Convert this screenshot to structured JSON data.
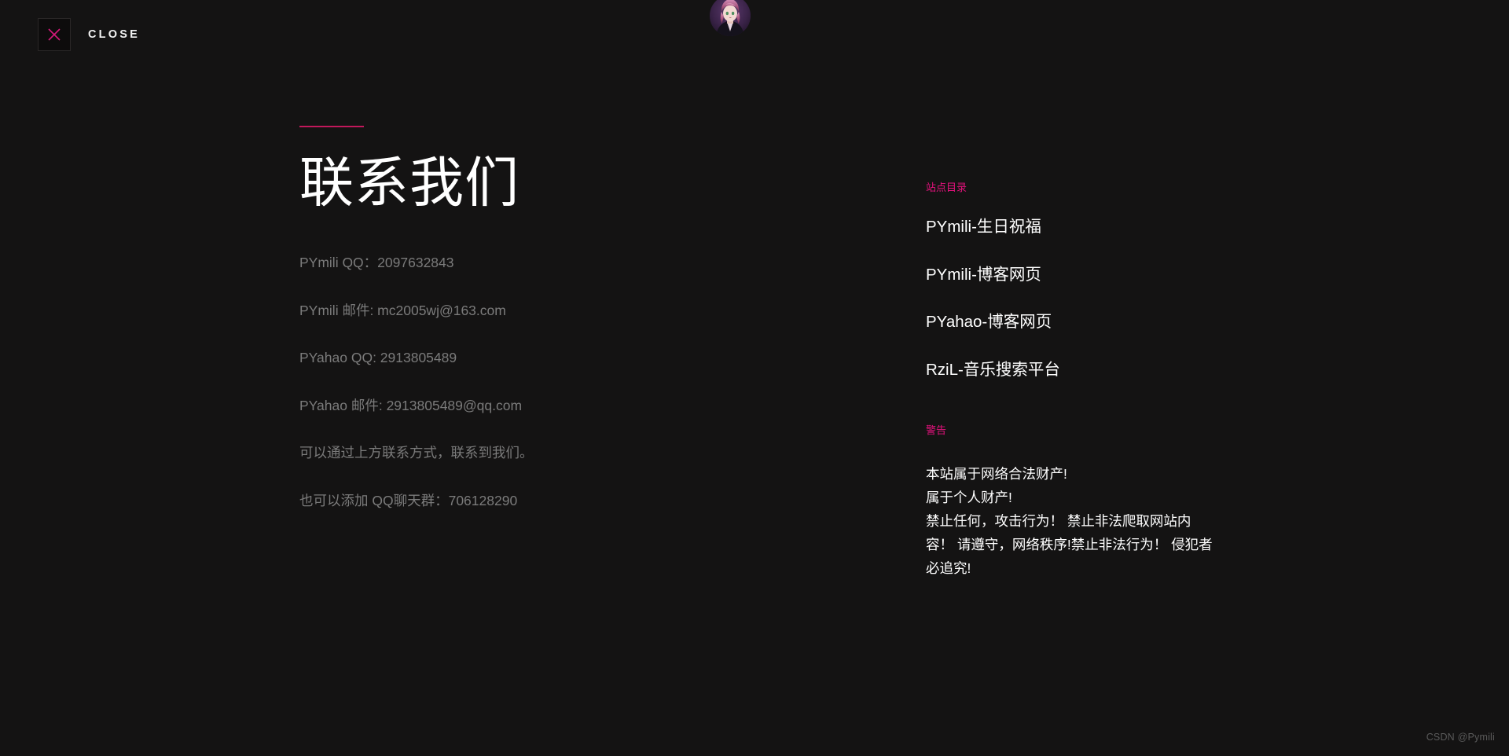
{
  "theme": {
    "background": "#141313",
    "accent_pink": "#e5127d",
    "accent_rule": "#c2185b",
    "muted_text": "#7b7b7b",
    "body_text": "#ffffff",
    "watermark_text_color": "#5a5a5a"
  },
  "topbar": {
    "close_label": "CLOSE",
    "close_icon": "close-x-icon",
    "avatar_icon": "user-avatar-image"
  },
  "main": {
    "title": "联系我们",
    "contacts": [
      "PYmili QQ：2097632843",
      "PYmili 邮件: mc2005wj@163.com",
      "PYahao QQ: 2913805489",
      "PYahao 邮件: 2913805489@qq.com",
      "可以通过上方联系方式，联系到我们。",
      "也可以添加 QQ聊天群：706128290"
    ]
  },
  "sidebar": {
    "directory_heading": "站点目录",
    "links": [
      "PYmili-生日祝福",
      "PYmili-博客网页",
      "PYahao-博客网页",
      "RziL-音乐搜索平台"
    ],
    "warning_heading": "警告",
    "warning_text": "本站属于网络合法财产!\n属于个人财产!\n禁止任何，攻击行为！ 禁止非法爬取网站内容！ 请遵守，网络秩序!禁止非法行为！ 侵犯者必追究!"
  },
  "footer": {
    "watermark": "CSDN @Pymili"
  }
}
